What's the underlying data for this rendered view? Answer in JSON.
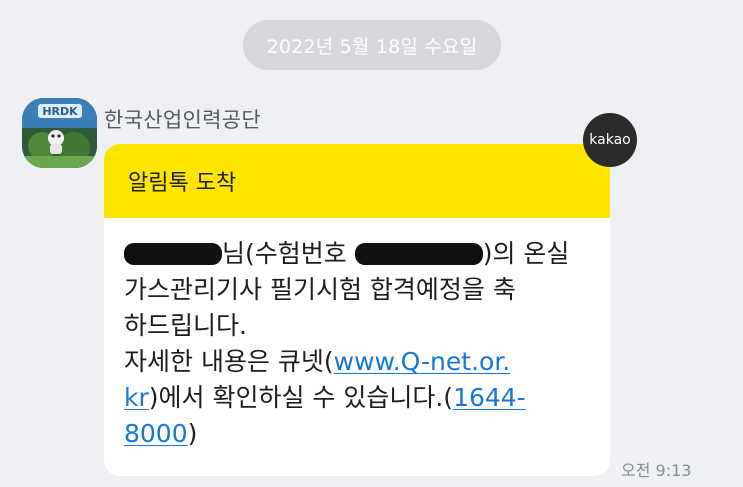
{
  "date_divider": "2022년 5월 18일 수요일",
  "sender": {
    "name": "한국산업인력공단",
    "avatar_text": "HRDK"
  },
  "badge": "kakao",
  "message": {
    "header": "알림톡 도착",
    "line1_name_suffix": "님(수험번호",
    "line1_tail": ")의 온실",
    "line2": "가스관리기사 필기시험 합격예정을 축",
    "line3": "하드립니다.",
    "line4_prefix": "자세한 내용은 큐넷(",
    "link_url_part1": "www.Q-net.or.",
    "link_url_part2": "kr",
    "line5_middle": ")에서 확인하실 수 있습니다.(",
    "phone_part1": "1644-",
    "phone_part2": "8000",
    "line6_tail": ")"
  },
  "time": "오전 9:13",
  "colors": {
    "background": "#eef0f4",
    "header_yellow": "#fde500",
    "link": "#1877d6"
  }
}
